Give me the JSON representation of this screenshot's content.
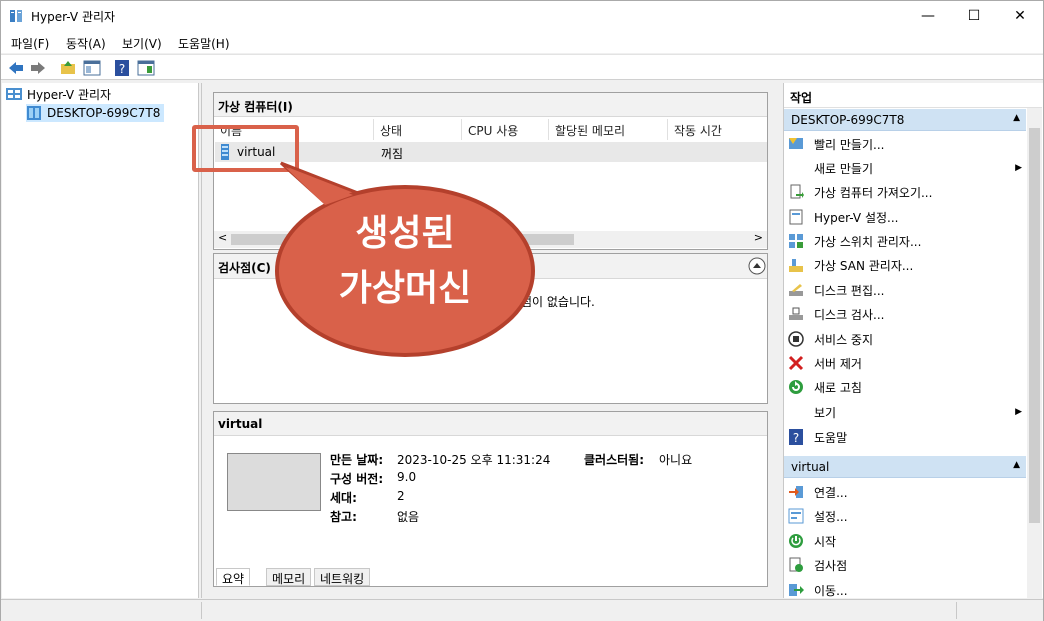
{
  "window": {
    "title": "Hyper-V 관리자",
    "minimize": "—",
    "maximize": "☐",
    "close": "✕"
  },
  "menu": [
    "파일(F)",
    "동작(A)",
    "보기(V)",
    "도움말(H)"
  ],
  "tree": {
    "root": "Hyper-V 관리자",
    "host": "DESKTOP-699C7T8"
  },
  "vm_panel": {
    "title": "가상 컴퓨터(I)",
    "columns": [
      "이름",
      "상태",
      "CPU 사용",
      "할당된 메모리",
      "작동 시간"
    ],
    "rows": [
      {
        "name": "virtual",
        "state": "꺼짐"
      }
    ]
  },
  "checkpoint_panel": {
    "title": "검사점(C)",
    "empty_text": "점이 없습니다."
  },
  "details": {
    "title": "virtual",
    "created_label": "만든 날짜:",
    "created_value": "2023-10-25 오후 11:31:24",
    "version_label": "구성 버전:",
    "version_value": "9.0",
    "generation_label": "세대:",
    "generation_value": "2",
    "notes_label": "참고:",
    "notes_value": "없음",
    "cluster_label": "클러스터됨:",
    "cluster_value": "아니요",
    "tabs": [
      "요약",
      "메모리",
      "네트워킹"
    ]
  },
  "callout": {
    "line1": "생성된",
    "line2": "가상머신",
    "color": "#d9614a"
  },
  "actions": {
    "header": "작업",
    "host_section": "DESKTOP-699C7T8",
    "host_items": [
      "빨리 만들기...",
      "새로 만들기",
      "가상 컴퓨터 가져오기...",
      "Hyper-V 설정...",
      "가상 스위치 관리자...",
      "가상 SAN 관리자...",
      "디스크 편집...",
      "디스크 검사...",
      "서비스 중지",
      "서버 제거",
      "새로 고침",
      "보기",
      "도움말"
    ],
    "vm_section": "virtual",
    "vm_items": [
      "연결...",
      "설정...",
      "시작",
      "검사점",
      "이동..."
    ]
  }
}
